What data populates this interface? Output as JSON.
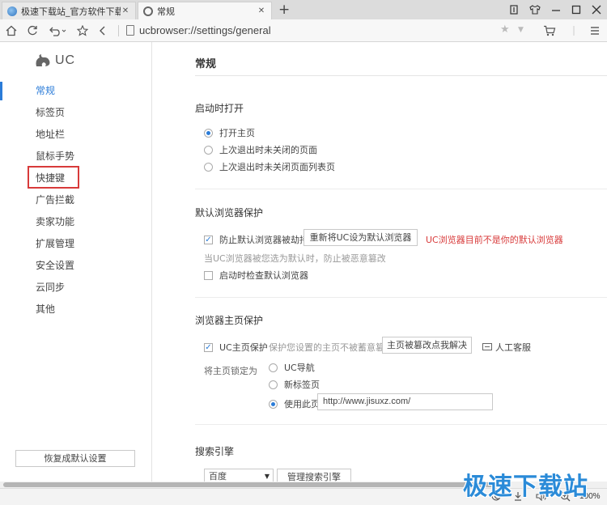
{
  "tabs": [
    {
      "title": "极速下载站_官方软件下载_绿色"
    },
    {
      "title": "常规"
    }
  ],
  "new_tab_label": "+",
  "window_controls": [
    "restore",
    "skin",
    "minimize",
    "maximize",
    "close"
  ],
  "address_bar": {
    "url": "ucbrowser://settings/general"
  },
  "sidebar": {
    "logo_text": "UC",
    "items": [
      {
        "label": "常规",
        "active": true
      },
      {
        "label": "标签页"
      },
      {
        "label": "地址栏"
      },
      {
        "label": "鼠标手势"
      },
      {
        "label": "快捷键",
        "highlighted": true
      },
      {
        "label": "广告拦截"
      },
      {
        "label": "卖家功能"
      },
      {
        "label": "扩展管理"
      },
      {
        "label": "安全设置"
      },
      {
        "label": "云同步"
      },
      {
        "label": "其他"
      }
    ],
    "reset_label": "恢复成默认设置"
  },
  "content": {
    "title": "常规",
    "startup": {
      "title": "启动时打开",
      "options": [
        {
          "label": "打开主页",
          "checked": true
        },
        {
          "label": "上次退出时未关闭的页面",
          "checked": false
        },
        {
          "label": "上次退出时未关闭页面列表页",
          "checked": false
        }
      ]
    },
    "default_browser": {
      "title": "默认浏览器保护",
      "protect_label": "防止默认浏览器被劫持",
      "protect_checked": true,
      "reset_button": "重新将UC设为默认浏览器",
      "warning": "UC浏览器目前不是你的默认浏览器",
      "hint": "当UC浏览器被您选为默认时，防止被恶意篡改",
      "check_startup_label": "启动时检查默认浏览器",
      "check_startup_checked": false
    },
    "homepage": {
      "title": "浏览器主页保护",
      "protect_label": "UC主页保护",
      "protect_checked": true,
      "hint": "保护您设置的主页不被蓄意篡改",
      "fix_button": "主页被篡改点我解决",
      "service_label": "人工客服",
      "lock_label": "将主页锁定为",
      "options": [
        {
          "label": "UC导航",
          "checked": false
        },
        {
          "label": "新标签页",
          "checked": false
        },
        {
          "label": "使用此页",
          "checked": true
        }
      ],
      "custom_url": "http://www.jisuxz.com/"
    },
    "search": {
      "title": "搜索引擎",
      "engine": "百度",
      "manage_button": "管理搜索引擎"
    }
  },
  "status_bar": {
    "zoom": "100%"
  },
  "watermark": "极速下载站"
}
